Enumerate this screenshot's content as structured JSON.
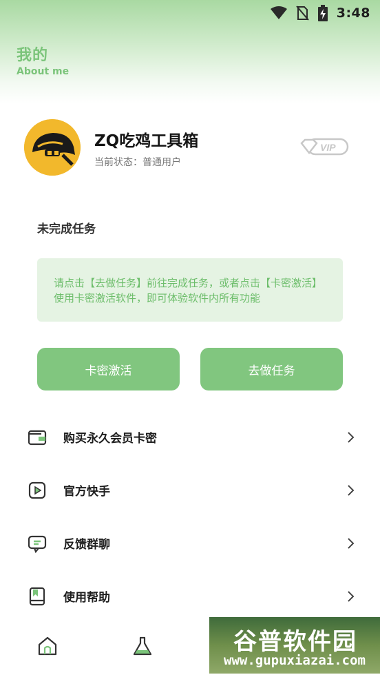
{
  "status_bar": {
    "time": "3:48",
    "icons": [
      "wifi-icon",
      "no-sim-icon",
      "battery-charging-icon"
    ]
  },
  "header": {
    "title": "我的",
    "subtitle": "About me"
  },
  "profile": {
    "name": "ZQ吃鸡工具箱",
    "status": "当前状态：普通用户",
    "avatar_icon": "helmet-avatar-icon",
    "vip_label": "VIP"
  },
  "tasks": {
    "section_title": "未完成任务",
    "notice": "请点击【去做任务】前往完成任务，或者点击【卡密激活】使用卡密激活软件，即可体验软件内所有功能",
    "activate_button": "卡密激活",
    "task_button": "去做任务"
  },
  "menu": {
    "items": [
      {
        "label": "购买永久会员卡密",
        "icon": "wallet-icon"
      },
      {
        "label": "官方快手",
        "icon": "video-play-icon"
      },
      {
        "label": "反馈群聊",
        "icon": "chat-icon"
      },
      {
        "label": "使用帮助",
        "icon": "book-icon"
      }
    ]
  },
  "bottom_nav": {
    "items": [
      {
        "icon": "home-icon"
      },
      {
        "icon": "flask-icon"
      }
    ]
  },
  "watermark": {
    "title": "谷普软件园",
    "url": "www.gupuxiazai.com"
  },
  "colors": {
    "accent": "#81c67f",
    "accent_text": "#7bc47a",
    "notice_bg": "#e5f3e3"
  }
}
